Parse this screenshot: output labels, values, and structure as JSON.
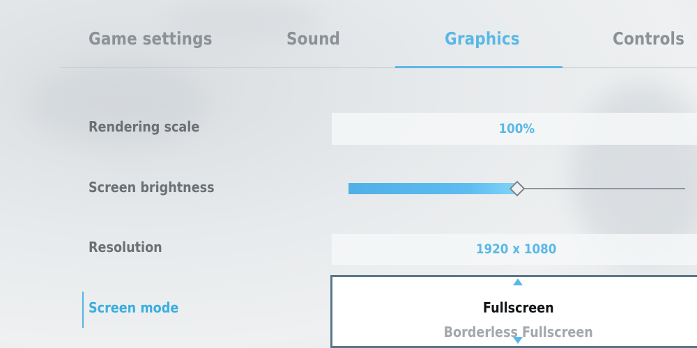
{
  "tabs": [
    {
      "label": "Game settings",
      "active": false
    },
    {
      "label": "Sound",
      "active": false
    },
    {
      "label": "Graphics",
      "active": true
    },
    {
      "label": "Controls",
      "active": false
    }
  ],
  "settings": {
    "rendering_scale": {
      "label": "Rendering scale",
      "value": "100%"
    },
    "screen_brightness": {
      "label": "Screen brightness",
      "level": 0.5
    },
    "resolution": {
      "label": "Resolution",
      "value": "1920 x 1080"
    },
    "screen_mode": {
      "label": "Screen mode",
      "selected": "Fullscreen",
      "next_option": "Borderless Fullscreen"
    }
  },
  "colors": {
    "accent": "#5ab8e6",
    "label": "#6b7074",
    "tab_inactive": "#8c9196",
    "dropdown_border": "#5a7788"
  },
  "icons": {
    "up": "chevron-up-icon",
    "down": "chevron-down-icon"
  }
}
